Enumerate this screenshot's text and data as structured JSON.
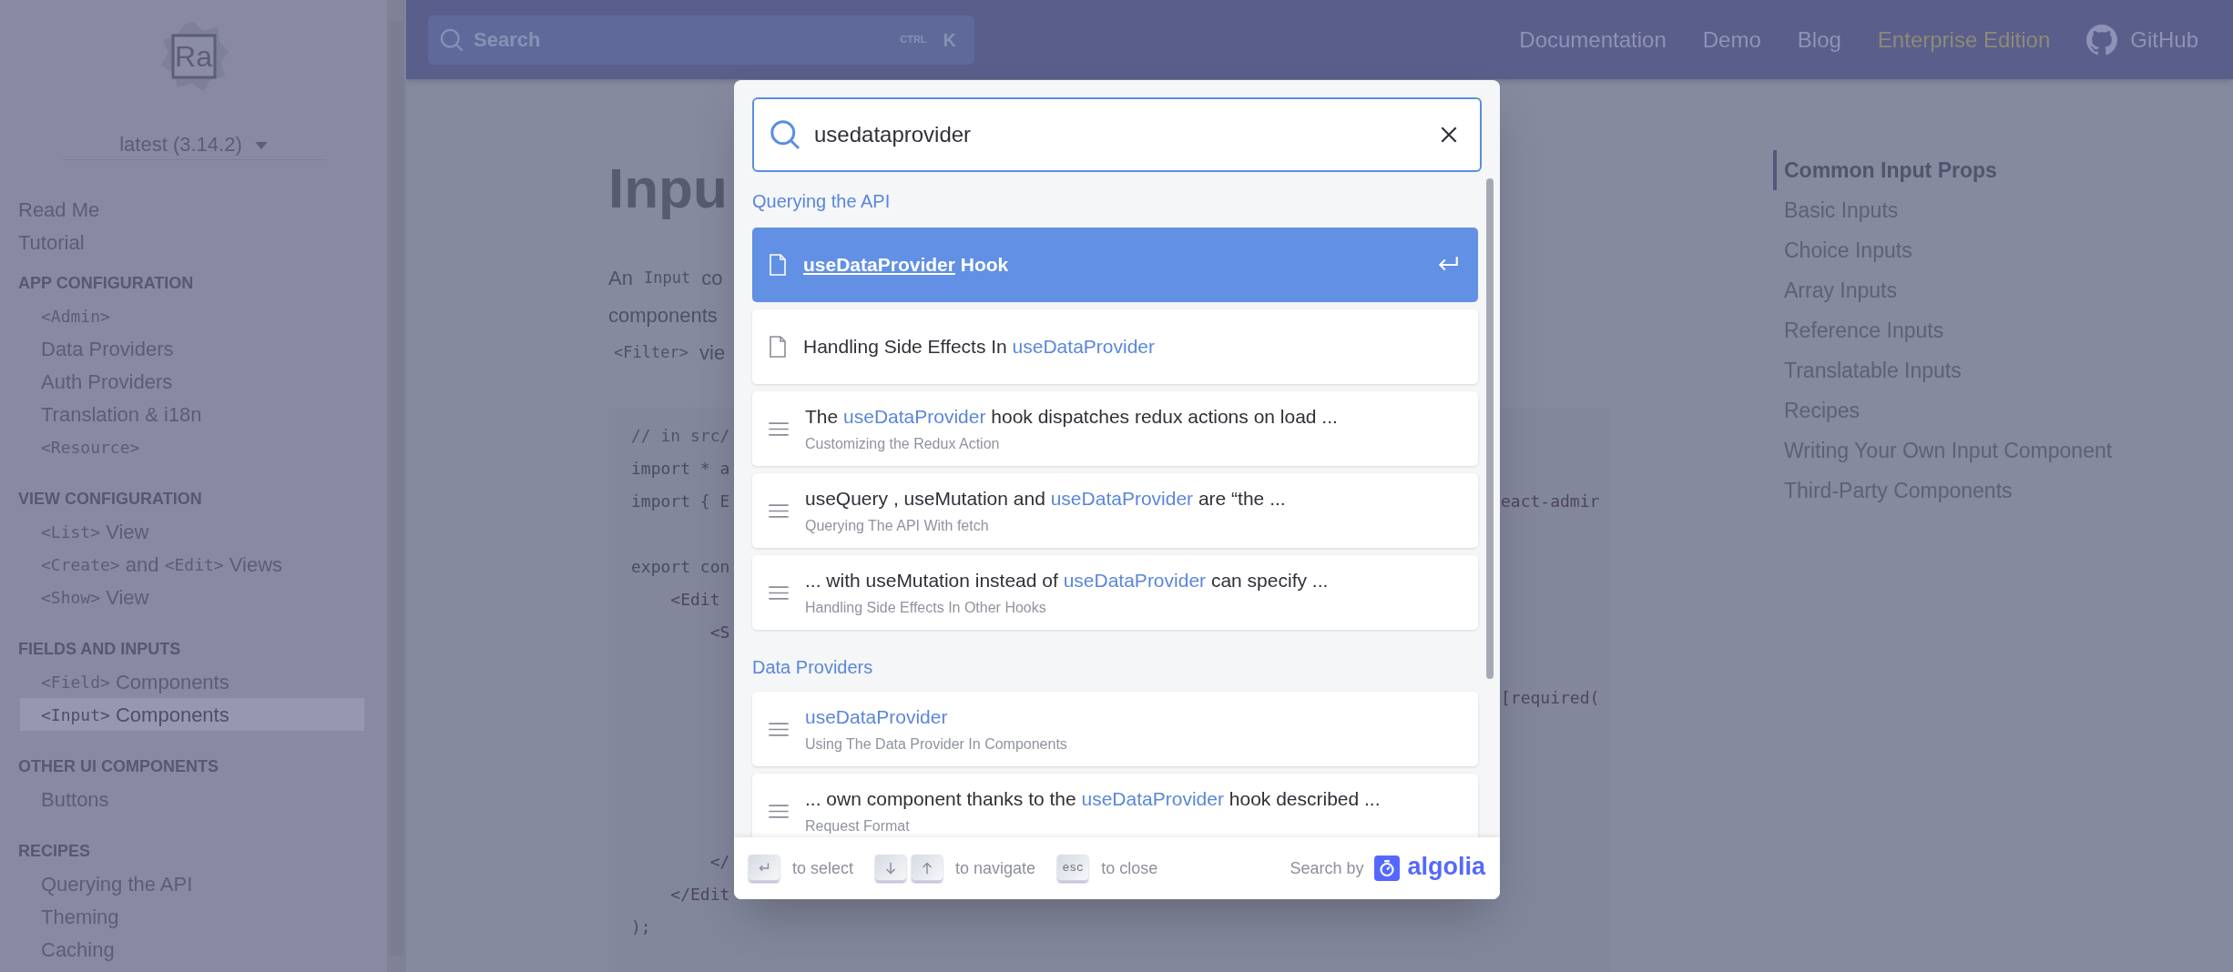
{
  "sidebar": {
    "logo": "Ra",
    "version": "latest (3.14.2)",
    "items": [
      {
        "kind": "link",
        "selected": false,
        "parts": [
          {
            "text": "Read Me"
          }
        ]
      },
      {
        "kind": "link",
        "selected": false,
        "parts": [
          {
            "text": "Tutorial"
          }
        ]
      },
      {
        "kind": "heading",
        "parts": [
          {
            "text": "APP CONFIGURATION"
          }
        ]
      },
      {
        "kind": "sublink",
        "selected": false,
        "parts": [
          {
            "text": "<Admin>",
            "code": true
          }
        ]
      },
      {
        "kind": "sublink",
        "selected": false,
        "parts": [
          {
            "text": "Data Providers"
          }
        ]
      },
      {
        "kind": "sublink",
        "selected": false,
        "parts": [
          {
            "text": "Auth Providers"
          }
        ]
      },
      {
        "kind": "sublink",
        "selected": false,
        "parts": [
          {
            "text": "Translation & i18n"
          }
        ]
      },
      {
        "kind": "sublink",
        "selected": false,
        "parts": [
          {
            "text": "<Resource>",
            "code": true
          }
        ]
      },
      {
        "kind": "heading",
        "parts": [
          {
            "text": "VIEW CONFIGURATION"
          }
        ]
      },
      {
        "kind": "sublink",
        "selected": false,
        "parts": [
          {
            "text": "<List>",
            "code": true
          },
          {
            "text": " View"
          }
        ]
      },
      {
        "kind": "sublink",
        "selected": false,
        "parts": [
          {
            "text": "<Create>",
            "code": true
          },
          {
            "text": " and "
          },
          {
            "text": "<Edit>",
            "code": true
          },
          {
            "text": " Views"
          }
        ]
      },
      {
        "kind": "sublink",
        "selected": false,
        "parts": [
          {
            "text": "<Show>",
            "code": true
          },
          {
            "text": " View"
          }
        ]
      },
      {
        "kind": "heading",
        "parts": [
          {
            "text": "FIELDS AND INPUTS"
          }
        ]
      },
      {
        "kind": "sublink",
        "selected": false,
        "parts": [
          {
            "text": "<Field>",
            "code": true
          },
          {
            "text": " Components"
          }
        ]
      },
      {
        "kind": "sublink",
        "selected": true,
        "parts": [
          {
            "text": "<Input>",
            "code": true
          },
          {
            "text": " Components"
          }
        ]
      },
      {
        "kind": "heading",
        "parts": [
          {
            "text": "OTHER UI COMPONENTS"
          }
        ]
      },
      {
        "kind": "sublink",
        "selected": false,
        "parts": [
          {
            "text": "Buttons"
          }
        ]
      },
      {
        "kind": "heading",
        "parts": [
          {
            "text": "RECIPES"
          }
        ]
      },
      {
        "kind": "sublink",
        "selected": false,
        "parts": [
          {
            "text": "Querying the API"
          }
        ]
      },
      {
        "kind": "sublink",
        "selected": false,
        "parts": [
          {
            "text": "Theming"
          }
        ]
      },
      {
        "kind": "sublink",
        "selected": false,
        "parts": [
          {
            "text": "Caching"
          }
        ]
      }
    ]
  },
  "header": {
    "search": {
      "placeholder": "Search",
      "keys": [
        "CTRL",
        "K"
      ]
    },
    "nav": [
      {
        "label": "Documentation",
        "kind": "link"
      },
      {
        "label": "Demo",
        "kind": "link"
      },
      {
        "label": "Blog",
        "kind": "link"
      },
      {
        "label": "Enterprise Edition",
        "kind": "highlight"
      },
      {
        "label": "GitHub",
        "kind": "github"
      }
    ]
  },
  "article": {
    "title": "Inpu",
    "intro": [
      [
        {
          "text": "An "
        },
        {
          "text": "Input",
          "code": true
        },
        {
          "text": " co"
        }
      ],
      [
        {
          "text": "components"
        }
      ],
      [
        {
          "text": "<Filter>",
          "code": true
        },
        {
          "text": " vie"
        }
      ]
    ],
    "code": [
      {
        "text": "// in src/",
        "kind": "comment"
      },
      {
        "text": "import * a",
        "kind": "plain"
      },
      {
        "text": "import { E",
        "kind": "plain",
        "tail": "eact-admir"
      },
      {
        "kind": "blank"
      },
      {
        "text": "export con",
        "kind": "plain"
      },
      {
        "text": "    <Edit ",
        "kind": "tag"
      },
      {
        "text": "        <S",
        "kind": "tag"
      },
      {
        "kind": "blank"
      },
      {
        "kind": "blank",
        "tail": "[required("
      },
      {
        "kind": "blank"
      },
      {
        "kind": "blank"
      },
      {
        "kind": "blank"
      },
      {
        "kind": "blank"
      },
      {
        "text": "        </",
        "kind": "tag"
      },
      {
        "text": "    </Edit",
        "kind": "tag"
      },
      {
        "text": ");",
        "kind": "plain"
      }
    ]
  },
  "toc": [
    {
      "label": "Common Input Props",
      "selected": true
    },
    {
      "label": "Basic Inputs",
      "selected": false
    },
    {
      "label": "Choice Inputs",
      "selected": false
    },
    {
      "label": "Array Inputs",
      "selected": false
    },
    {
      "label": "Reference Inputs",
      "selected": false
    },
    {
      "label": "Translatable Inputs",
      "selected": false
    },
    {
      "label": "Recipes",
      "selected": false
    },
    {
      "label": "Writing Your Own Input Component",
      "selected": false
    },
    {
      "label": "Third-Party Components",
      "selected": false
    }
  ],
  "search_modal": {
    "query": "usedataprovider",
    "sections": [
      {
        "title": "Querying the API",
        "hits": [
          {
            "kind": "page",
            "selected": true,
            "title": [
              {
                "text": "useDataProvider",
                "highlight": true
              },
              {
                "text": " Hook"
              }
            ]
          },
          {
            "kind": "page",
            "selected": false,
            "title": [
              {
                "text": "Handling Side Effects In "
              },
              {
                "text": "useDataProvider",
                "highlight": true
              }
            ]
          },
          {
            "kind": "content",
            "selected": false,
            "title": [
              {
                "text": "The "
              },
              {
                "text": "useDataProvider",
                "highlight": true
              },
              {
                "text": " hook dispatches redux actions on load ..."
              }
            ],
            "subtitle": "Customizing the Redux Action"
          },
          {
            "kind": "content",
            "selected": false,
            "title": [
              {
                "text": "useQuery , useMutation and "
              },
              {
                "text": "useDataProvider",
                "highlight": true
              },
              {
                "text": " are “the ..."
              }
            ],
            "subtitle": "Querying The API With fetch"
          },
          {
            "kind": "content",
            "selected": false,
            "title": [
              {
                "text": "... with useMutation instead of "
              },
              {
                "text": "useDataProvider",
                "highlight": true
              },
              {
                "text": " can specify ..."
              }
            ],
            "subtitle": "Handling Side Effects In Other Hooks"
          }
        ]
      },
      {
        "title": "Data Providers",
        "hits": [
          {
            "kind": "content",
            "selected": false,
            "title": [
              {
                "text": "useDataProvider",
                "highlight": true
              }
            ],
            "subtitle": "Using The Data Provider In Components"
          },
          {
            "kind": "content",
            "selected": false,
            "title": [
              {
                "text": "... own component thanks to the "
              },
              {
                "text": "useDataProvider",
                "highlight": true
              },
              {
                "text": " hook described ..."
              }
            ],
            "subtitle": "Request Format"
          }
        ]
      }
    ],
    "footer": {
      "commands": [
        {
          "keys": [
            {
              "kind": "enter"
            }
          ],
          "label": "to select"
        },
        {
          "keys": [
            {
              "kind": "down"
            },
            {
              "kind": "up"
            }
          ],
          "label": "to navigate"
        },
        {
          "keys": [
            {
              "kind": "text",
              "label": "esc"
            }
          ],
          "label": "to close"
        }
      ],
      "search_by": "Search by",
      "brand": "algolia"
    }
  }
}
